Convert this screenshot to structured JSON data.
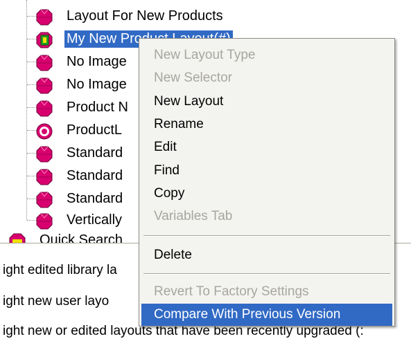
{
  "tree": {
    "items": [
      {
        "label": "Layout For New Products",
        "icon": "layout-icon"
      },
      {
        "label": "My New Product Layout(#)",
        "icon": "user-layout-icon",
        "selected": true
      },
      {
        "label": "No Image",
        "icon": "layout-icon"
      },
      {
        "label": "No Image",
        "icon": "layout-icon"
      },
      {
        "label": "Product N",
        "icon": "layout-icon"
      },
      {
        "label": "ProductL",
        "icon": "product-layout-icon"
      },
      {
        "label": "Standard",
        "icon": "layout-icon"
      },
      {
        "label": "Standard",
        "icon": "layout-icon"
      },
      {
        "label": "Standard",
        "icon": "layout-icon"
      },
      {
        "label": "Vertically",
        "icon": "layout-icon"
      }
    ],
    "root_item": {
      "label": "Quick Search",
      "icon": "layout-type-icon"
    }
  },
  "legend": {
    "lines": [
      "ight edited library la",
      "ight new user layo",
      "ight new or edited layouts that have been recently upgraded (:"
    ]
  },
  "context_menu": {
    "items": [
      {
        "label": "New Layout Type",
        "disabled": true
      },
      {
        "label": "New Selector",
        "disabled": true
      },
      {
        "label": "New Layout",
        "disabled": false
      },
      {
        "label": "Rename",
        "disabled": false
      },
      {
        "label": "Edit",
        "disabled": false
      },
      {
        "label": "Find",
        "disabled": false
      },
      {
        "label": "Copy",
        "disabled": false
      },
      {
        "label": "Variables Tab",
        "disabled": true
      },
      {
        "label": "Delete",
        "disabled": false
      },
      {
        "label": "Revert To Factory Settings",
        "disabled": true
      },
      {
        "label": "Compare With Previous Version",
        "disabled": false,
        "highlighted": true
      }
    ]
  },
  "colors": {
    "selection": "#316ac5",
    "icon_magenta": "#d8006f",
    "icon_green": "#20a020",
    "icon_yellow": "#f2e000",
    "menu_bg": "#f3f3f0",
    "disabled_text": "#a7a69f"
  }
}
